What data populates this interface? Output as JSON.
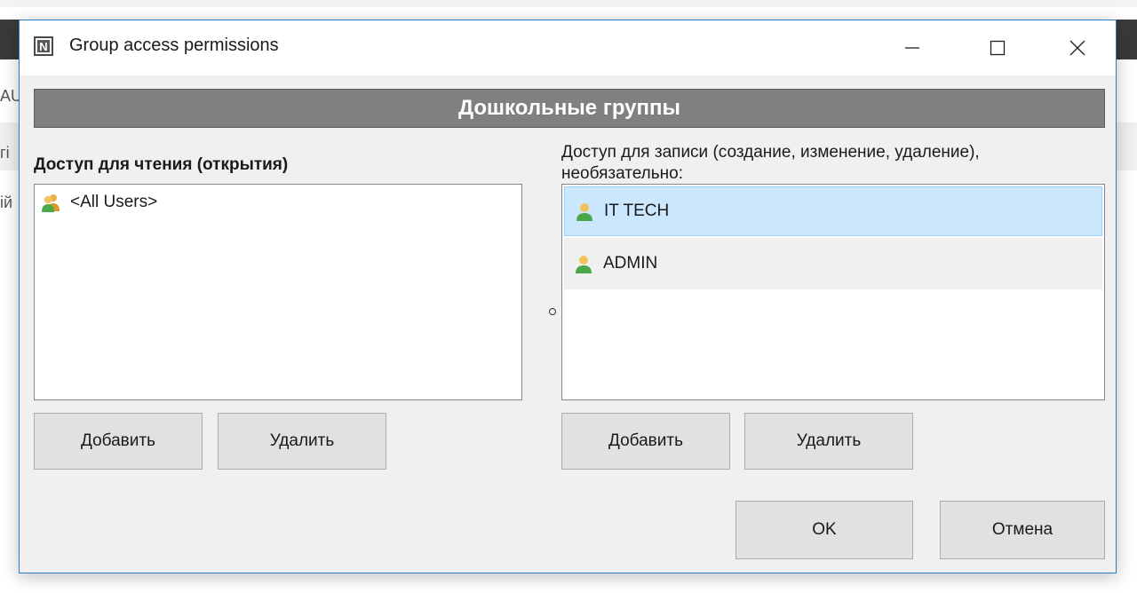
{
  "background": {
    "fragments": [
      "AU",
      "гі",
      "ій"
    ]
  },
  "window": {
    "title": "Group access permissions",
    "icon": "N",
    "controls": {
      "minimize": "minimize-icon",
      "maximize": "maximize-icon",
      "close": "close-icon"
    }
  },
  "group_title": "Дошкольные группы",
  "read": {
    "label": "Доступ для чтения (открытия)",
    "items": [
      {
        "name": "<All Users>",
        "icon": "users-group-icon"
      }
    ],
    "add_label": "Добавить",
    "remove_label": "Удалить"
  },
  "write": {
    "label": "Доступ для записи (создание, изменение, удаление), необязательно:",
    "items": [
      {
        "name": "IT TECH",
        "icon": "user-icon",
        "selected": true
      },
      {
        "name": "ADMIN",
        "icon": "user-icon",
        "selected": false
      }
    ],
    "add_label": "Добавить",
    "remove_label": "Удалить"
  },
  "separator": "о",
  "ok_label": "OK",
  "cancel_label": "Отмена",
  "colors": {
    "accent": "#2b79d0",
    "selection": "#cce8ff",
    "header": "#808080"
  }
}
